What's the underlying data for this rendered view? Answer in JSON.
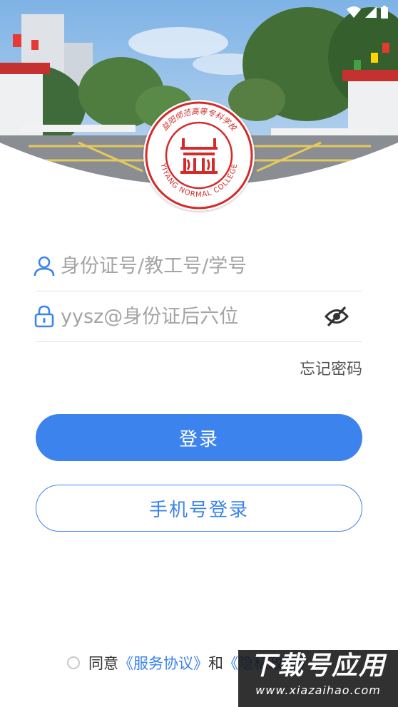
{
  "header": {
    "logo": {
      "name_cn": "益阳师范高等专科学校",
      "name_en": "YIYANG NORMAL COLLEGE"
    }
  },
  "login": {
    "account_placeholder": "身份证号/教工号/学号",
    "password_placeholder": "yysz@身份证后六位",
    "forgot_password": "忘记密码",
    "login_button": "登录",
    "phone_login_button": "手机号登录"
  },
  "agreement": {
    "agree_text": "同意",
    "service_terms": "《服务协议》",
    "and_text": "和",
    "privacy_policy": "《隐私政策》"
  },
  "watermark": {
    "title": "下载号应用",
    "url": "www.xiazaihao.com"
  },
  "colors": {
    "primary": "#3c83ee",
    "logo_red": "#d42a2a",
    "placeholder": "#a4a4a4"
  },
  "icons": [
    "user-icon",
    "lock-icon",
    "eye-off-icon",
    "wifi-icon",
    "signal-icon",
    "battery-icon"
  ]
}
